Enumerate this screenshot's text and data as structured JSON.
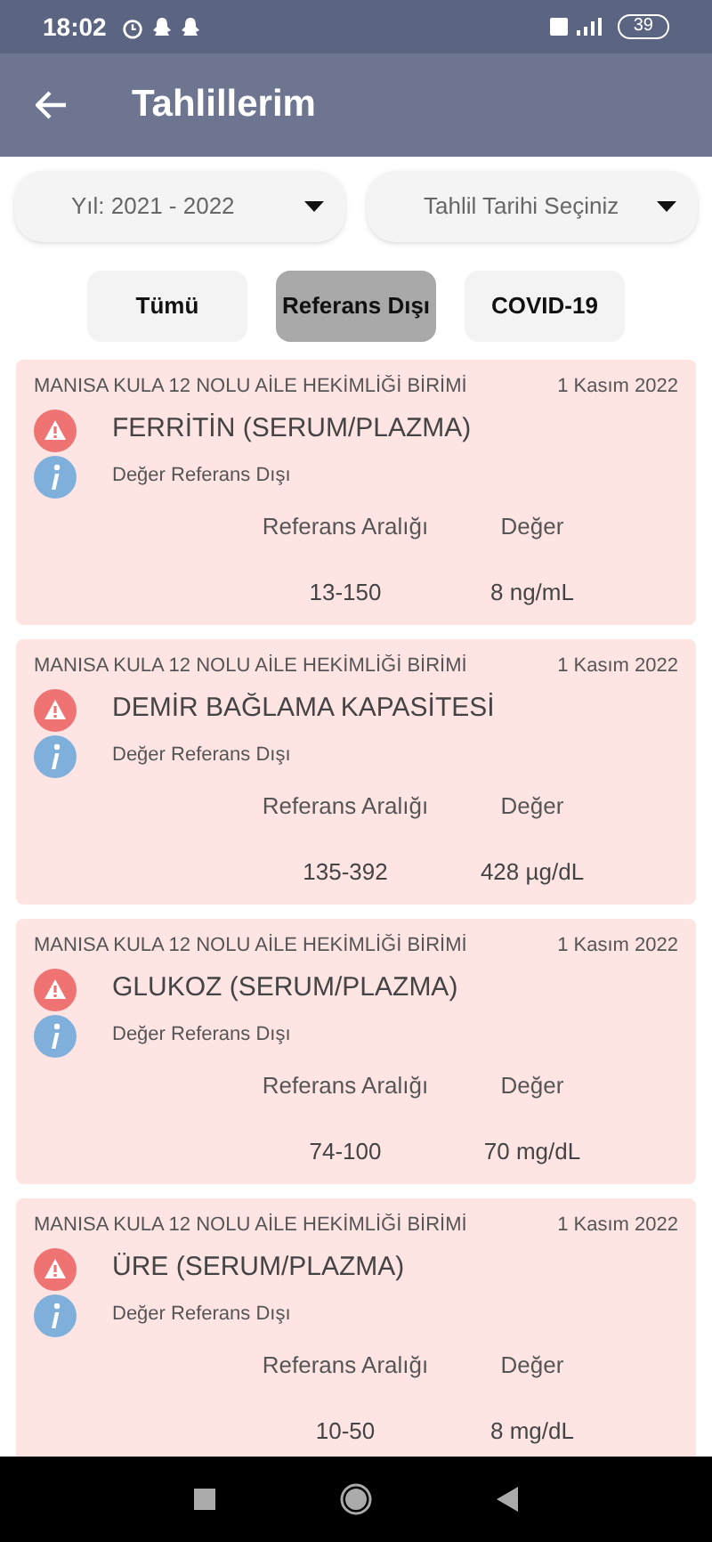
{
  "status_bar": {
    "time": "18:02",
    "battery": "39"
  },
  "app_bar": {
    "title": "Tahlillerim"
  },
  "filters": [
    {
      "label": "Yıl: 2021 - 2022"
    },
    {
      "label": "Tahlil Tarihi Seçiniz"
    }
  ],
  "tabs": [
    {
      "label": "Tümü",
      "selected": false
    },
    {
      "label": "Referans Dışı",
      "selected": true
    },
    {
      "label": "COVID-19",
      "selected": false
    }
  ],
  "results": [
    {
      "facility": "MANISA KULA 12 NOLU AİLE HEKİMLİĞİ BİRİMİ",
      "date": "1 Kasım 2022",
      "test": "FERRİTİN (SERUM/PLAZMA)",
      "status": "Değer Referans Dışı",
      "range_label": "Referans Aralığı",
      "value_label": "Değer",
      "range": "13-150",
      "value": "8 ng/mL"
    },
    {
      "facility": "MANISA KULA 12 NOLU AİLE HEKİMLİĞİ BİRİMİ",
      "date": "1 Kasım 2022",
      "test": "DEMİR BAĞLAMA KAPASİTESİ",
      "status": "Değer Referans Dışı",
      "range_label": "Referans Aralığı",
      "value_label": "Değer",
      "range": "135-392",
      "value": "428 µg/dL"
    },
    {
      "facility": "MANISA KULA 12 NOLU AİLE HEKİMLİĞİ BİRİMİ",
      "date": "1 Kasım 2022",
      "test": "GLUKOZ (SERUM/PLAZMA)",
      "status": "Değer Referans Dışı",
      "range_label": "Referans Aralığı",
      "value_label": "Değer",
      "range": "74-100",
      "value": "70 mg/dL"
    },
    {
      "facility": "MANISA KULA 12 NOLU AİLE HEKİMLİĞİ BİRİMİ",
      "date": "1 Kasım 2022",
      "test": "ÜRE (SERUM/PLAZMA)",
      "status": "Değer Referans Dışı",
      "range_label": "Referans Aralığı",
      "value_label": "Değer",
      "range": "10-50",
      "value": "8 mg/dL"
    }
  ]
}
